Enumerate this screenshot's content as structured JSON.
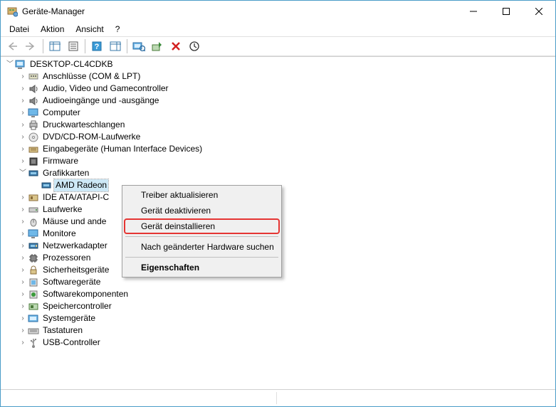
{
  "window": {
    "title": "Geräte-Manager"
  },
  "menu": {
    "file": "Datei",
    "action": "Aktion",
    "view": "Ansicht",
    "help": "?"
  },
  "tree": {
    "root": "DESKTOP-CL4CDKB",
    "categories": [
      {
        "label": "Anschlüsse (COM & LPT)"
      },
      {
        "label": "Audio, Video und Gamecontroller"
      },
      {
        "label": "Audioeingänge und -ausgänge"
      },
      {
        "label": "Computer"
      },
      {
        "label": "Druckwarteschlangen"
      },
      {
        "label": "DVD/CD-ROM-Laufwerke"
      },
      {
        "label": "Eingabegeräte (Human Interface Devices)"
      },
      {
        "label": "Firmware"
      },
      {
        "label": "Grafikkarten",
        "expanded": true,
        "children": [
          {
            "label": "AMD Radeon",
            "selected": true
          }
        ]
      },
      {
        "label": "IDE ATA/ATAPI-C"
      },
      {
        "label": "Laufwerke"
      },
      {
        "label": "Mäuse und ande"
      },
      {
        "label": "Monitore"
      },
      {
        "label": "Netzwerkadapter"
      },
      {
        "label": "Prozessoren"
      },
      {
        "label": "Sicherheitsgeräte"
      },
      {
        "label": "Softwaregeräte"
      },
      {
        "label": "Softwarekomponenten"
      },
      {
        "label": "Speichercontroller"
      },
      {
        "label": "Systemgeräte"
      },
      {
        "label": "Tastaturen"
      },
      {
        "label": "USB-Controller"
      }
    ]
  },
  "context_menu": {
    "update_driver": "Treiber aktualisieren",
    "disable_device": "Gerät deaktivieren",
    "uninstall_device": "Gerät deinstallieren",
    "scan_hardware": "Nach geänderter Hardware suchen",
    "properties": "Eigenschaften"
  }
}
